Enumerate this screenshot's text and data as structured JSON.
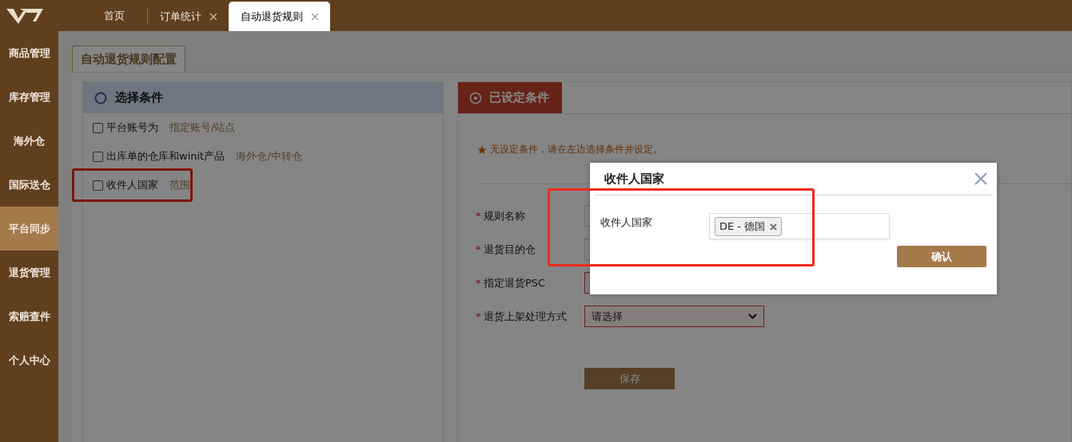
{
  "tabs": [
    {
      "label": "首页",
      "closable": false,
      "selected": false
    },
    {
      "label": "订单统计",
      "closable": true,
      "selected": false
    },
    {
      "label": "自动退货规则",
      "closable": true,
      "selected": true
    }
  ],
  "sidebar": {
    "items": [
      {
        "label": "商品管理",
        "selected": false
      },
      {
        "label": "库存管理",
        "selected": false
      },
      {
        "label": "海外仓",
        "selected": false
      },
      {
        "label": "国际送仓",
        "selected": false
      },
      {
        "label": "平台同步",
        "selected": true
      },
      {
        "label": "退货管理",
        "selected": false
      },
      {
        "label": "索赔查件",
        "selected": false
      },
      {
        "label": "个人中心",
        "selected": false
      }
    ]
  },
  "page_tab": "自动退货规则配置",
  "left_panel": {
    "title": "选择条件",
    "conditions": [
      {
        "label": "平台账号为",
        "hint": "指定账号/站点",
        "checked": false,
        "highlighted": false
      },
      {
        "label": "出库单的仓库和winit产品",
        "hint": "海外仓/中转仓",
        "checked": false,
        "highlighted": false
      },
      {
        "label": "收件人国家",
        "hint": "范围",
        "checked": false,
        "highlighted": true
      }
    ]
  },
  "right_panel": {
    "title": "已设定条件",
    "notice": "无设定条件，请在左边选择条件并设定。",
    "fields": [
      {
        "marker": "*",
        "label": "规则名称",
        "kind": "input",
        "invalid": false
      },
      {
        "marker": "*",
        "label": "退货目的仓",
        "kind": "input",
        "invalid": false
      },
      {
        "marker": "*",
        "label": "指定退货PSC",
        "kind": "input",
        "invalid": true
      },
      {
        "marker": "*",
        "label": "退货上架处理方式",
        "kind": "select",
        "value": "请选择",
        "invalid": true
      }
    ],
    "save_button": "保存"
  },
  "modal": {
    "title": "收件人国家",
    "field_label": "收件人国家",
    "tags": [
      "DE - 德国"
    ],
    "confirm_button": "确认",
    "highlighted": true
  }
}
